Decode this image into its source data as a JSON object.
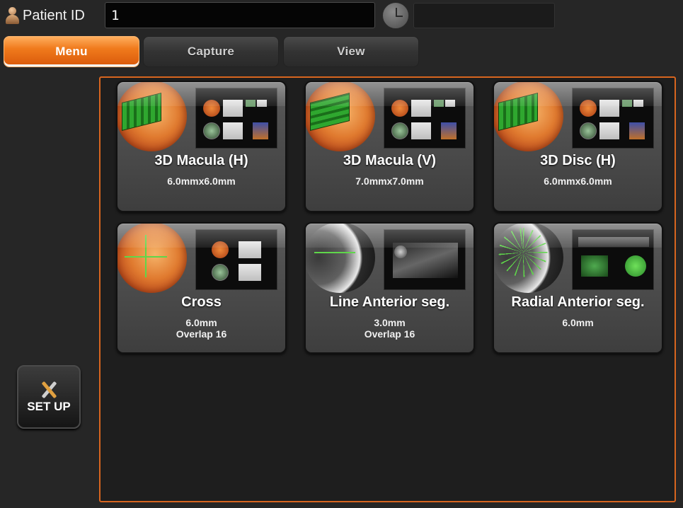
{
  "header": {
    "patient_id_label": "Patient ID",
    "patient_id_value": "1",
    "time_value": ""
  },
  "tabs": [
    {
      "label": "Menu",
      "active": true
    },
    {
      "label": "Capture",
      "active": false
    },
    {
      "label": "View",
      "active": false
    }
  ],
  "scan_modes": [
    {
      "title": "3D Macula (H)",
      "subtitle": "6.0mmx6.0mm",
      "icon": "macula-cube-icon"
    },
    {
      "title": "3D Macula (V)",
      "subtitle": "7.0mmx7.0mm",
      "icon": "macula-cube-icon"
    },
    {
      "title": "3D Disc (H)",
      "subtitle": "6.0mmx6.0mm",
      "icon": "disc-cube-icon"
    },
    {
      "title": "Cross",
      "subtitle": "6.0mm\nOverlap 16",
      "icon": "cross-scan-icon"
    },
    {
      "title": "Line Anterior seg.",
      "subtitle": "3.0mm\nOverlap 16",
      "icon": "line-anterior-icon"
    },
    {
      "title": "Radial Anterior seg.",
      "subtitle": "6.0mm",
      "icon": "radial-anterior-icon"
    }
  ],
  "setup": {
    "label": "SET UP",
    "icon": "tools-icon"
  },
  "colors": {
    "accent": "#e8731c",
    "panel_border": "#d7651f",
    "background": "#262626"
  }
}
